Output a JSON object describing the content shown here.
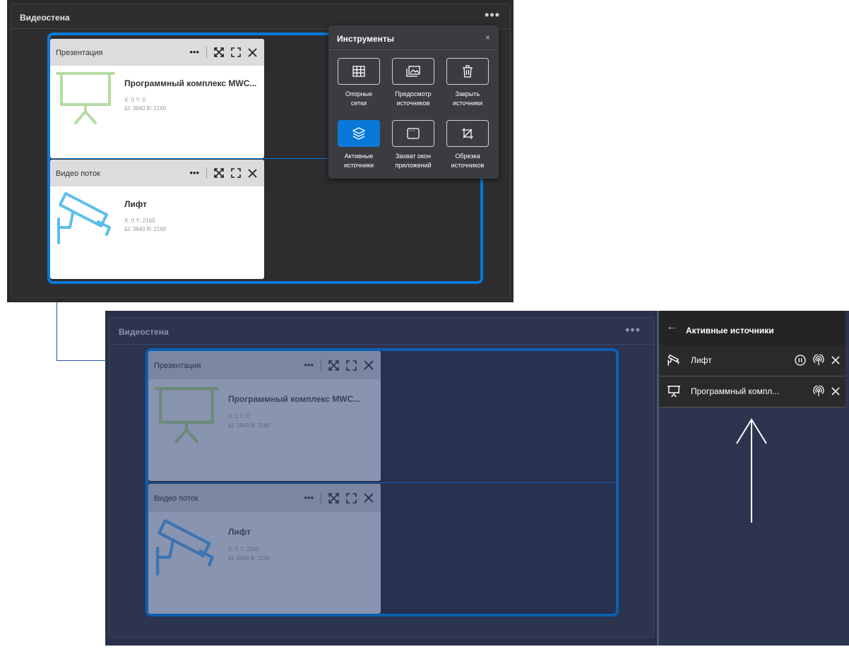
{
  "top": {
    "videowall": {
      "title": "Видеостена",
      "menu": "•••"
    },
    "cards": [
      {
        "header": "Презентация",
        "menu": "•••",
        "title": "Программный комплекс MWC...",
        "position": "X: 0 Y: 0",
        "size": "Ш: 3840 В: 2160",
        "icon": "presentation-icon"
      },
      {
        "header": "Видео поток",
        "menu": "•••",
        "title": "Лифт",
        "position": "X: 0 Y: 2160",
        "size": "Ш: 3840 В: 2160",
        "icon": "cctv-camera-icon"
      }
    ],
    "tools": {
      "title": "Инструменты",
      "close": "×",
      "items": [
        {
          "label": "Опорные\nсетки",
          "icon": "grid-icon",
          "active": false
        },
        {
          "label": "Предосмотр\nисточников",
          "icon": "gallery-icon",
          "active": false
        },
        {
          "label": "Закрыть\nисточники",
          "icon": "trash-icon",
          "active": false
        },
        {
          "label": "Активные\nисточники",
          "icon": "layers-icon",
          "active": true
        },
        {
          "label": "Захват окон\nприложений",
          "icon": "window-icon",
          "active": false
        },
        {
          "label": "Обрезка\nисточников",
          "icon": "crop-icon",
          "active": false
        }
      ]
    }
  },
  "bottom": {
    "videowall": {
      "title": "Видеостена",
      "menu": "•••"
    },
    "cards": [
      {
        "header": "Презентация",
        "menu": "•••",
        "title": "Программный комплекс MWC...",
        "position": "X: 0 Y: 0",
        "size": "Ш: 3840 В: 2160",
        "icon": "presentation-icon"
      },
      {
        "header": "Видео поток",
        "menu": "•••",
        "title": "Лифт",
        "position": "X: 0 Y: 2160",
        "size": "Ш: 3840 В: 2160",
        "icon": "cctv-camera-icon"
      }
    ],
    "active_sources": {
      "back": "←",
      "title": "Активные источники",
      "items": [
        {
          "name": "Лифт",
          "icon": "cctv-camera-icon",
          "controls": [
            "pause-icon",
            "broadcast-icon",
            "close-icon"
          ]
        },
        {
          "name": "Программный компл...",
          "icon": "presentation-icon",
          "controls": [
            "broadcast-icon",
            "close-icon"
          ]
        }
      ]
    }
  },
  "colors": {
    "accent": "#0a78d8",
    "presentation_icon": "#b5dba4",
    "camera_icon": "#5bbfea",
    "dark_panel": "#2e2e30",
    "dim_panel": "#2c3450"
  }
}
